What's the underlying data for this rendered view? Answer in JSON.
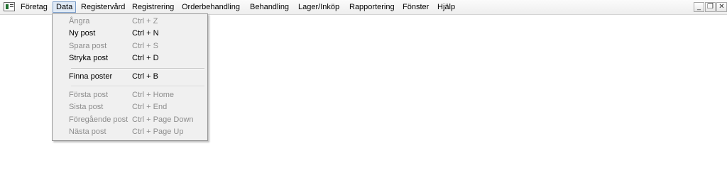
{
  "menubar": {
    "items": [
      {
        "label": "Företag"
      },
      {
        "label": "Data"
      },
      {
        "label": "Registervård"
      },
      {
        "label": "Registrering"
      },
      {
        "label": "Orderbehandling"
      },
      {
        "label": "Behandling"
      },
      {
        "label": "Lager/Inköp"
      },
      {
        "label": "Rapportering"
      },
      {
        "label": "Fönster"
      },
      {
        "label": "Hjälp"
      }
    ],
    "window_controls": {
      "minimize_glyph": "_",
      "restore_glyph": "❐",
      "close_glyph": "✕"
    }
  },
  "data_menu": {
    "items": [
      {
        "label": "Ångra",
        "shortcut": "Ctrl + Z",
        "enabled": false
      },
      {
        "label": "Ny post",
        "shortcut": "Ctrl + N",
        "enabled": true
      },
      {
        "label": "Spara post",
        "shortcut": "Ctrl + S",
        "enabled": false
      },
      {
        "label": "Stryka post",
        "shortcut": "Ctrl + D",
        "enabled": true
      },
      {
        "label": "Finna poster",
        "shortcut": "Ctrl + B",
        "enabled": true
      },
      {
        "label": "Första post",
        "shortcut": "Ctrl + Home",
        "enabled": false
      },
      {
        "label": "Sista post",
        "shortcut": "Ctrl + End",
        "enabled": false
      },
      {
        "label": "Föregående post",
        "shortcut": "Ctrl + Page Down",
        "enabled": false
      },
      {
        "label": "Nästa post",
        "shortcut": "Ctrl + Page Up",
        "enabled": false
      }
    ]
  },
  "colors": {
    "disabled_text": "#8d8d8d",
    "open_menu_highlight": "#dfe9f5"
  }
}
